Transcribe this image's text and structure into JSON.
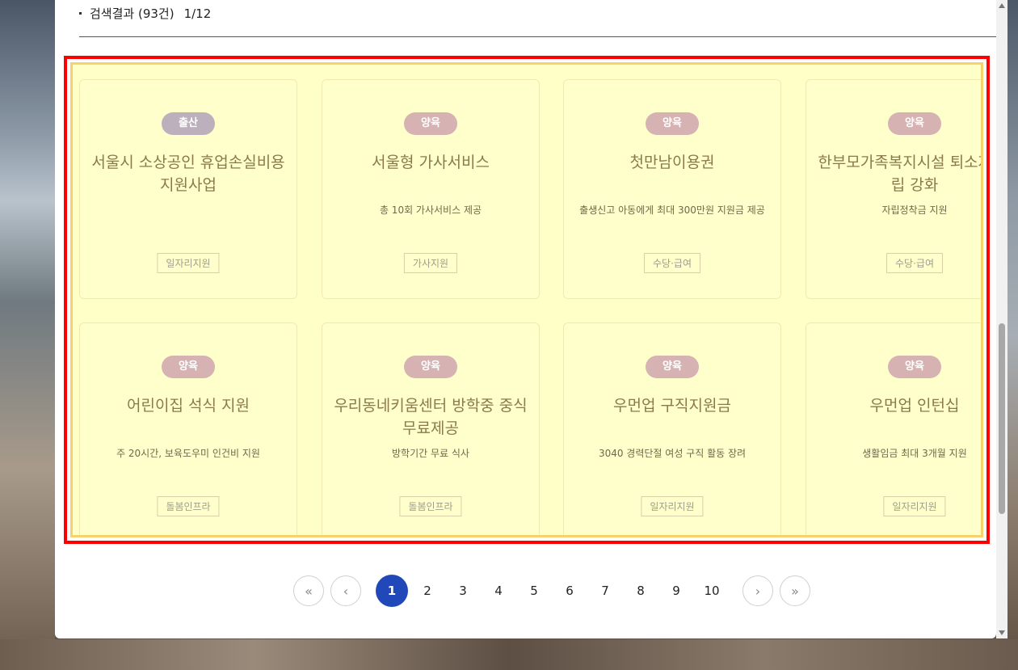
{
  "results": {
    "label": "검색결과 (93건)",
    "page_indicator": "1/12"
  },
  "cards": [
    {
      "badge": "출산",
      "title": "서울시 소상공인 휴업손실비용 지원사업",
      "title_line1": "서울시 소상공인 휴업손실비용",
      "title_line2": "지원사업",
      "desc": "",
      "tag": "일자리지원"
    },
    {
      "badge": "양육",
      "title_line1": "서울형 가사서비스",
      "title_line2": "",
      "desc": "총 10회 가사서비스 제공",
      "tag": "가사지원"
    },
    {
      "badge": "양육",
      "title_line1": "첫만남이용권",
      "title_line2": "",
      "desc": "출생신고 아동에게 최대 300만원 지원금 제공",
      "tag": "수당·급여"
    },
    {
      "badge": "양육",
      "title_line1": "한부모가족복지시설 퇴소자 자",
      "title_line2": "립 강화",
      "desc": "자립정착금 지원",
      "tag": "수당·급여"
    },
    {
      "badge": "양육",
      "title_line1": "어린이집 석식 지원",
      "title_line2": "",
      "desc": "주 20시간, 보육도우미 인건비 지원",
      "tag": "돌봄인프라"
    },
    {
      "badge": "양육",
      "title_line1": "우리동네키움센터 방학중 중식",
      "title_line2": "무료제공",
      "desc": "방학기간 무료 식사",
      "tag": "돌봄인프라"
    },
    {
      "badge": "양육",
      "title_line1": "우먼업 구직지원금",
      "title_line2": "",
      "desc": "3040 경력단절 여성 구직 활동 장려",
      "tag": "일자리지원"
    },
    {
      "badge": "양육",
      "title_line1": "우먼업 인턴십",
      "title_line2": "",
      "desc": "생활임금 최대 3개월 지원",
      "tag": "일자리지원"
    }
  ],
  "pagination": {
    "first": "«",
    "prev": "‹",
    "next": "›",
    "last": "»",
    "pages": [
      "1",
      "2",
      "3",
      "4",
      "5",
      "6",
      "7",
      "8",
      "9",
      "10"
    ],
    "current": "1"
  }
}
